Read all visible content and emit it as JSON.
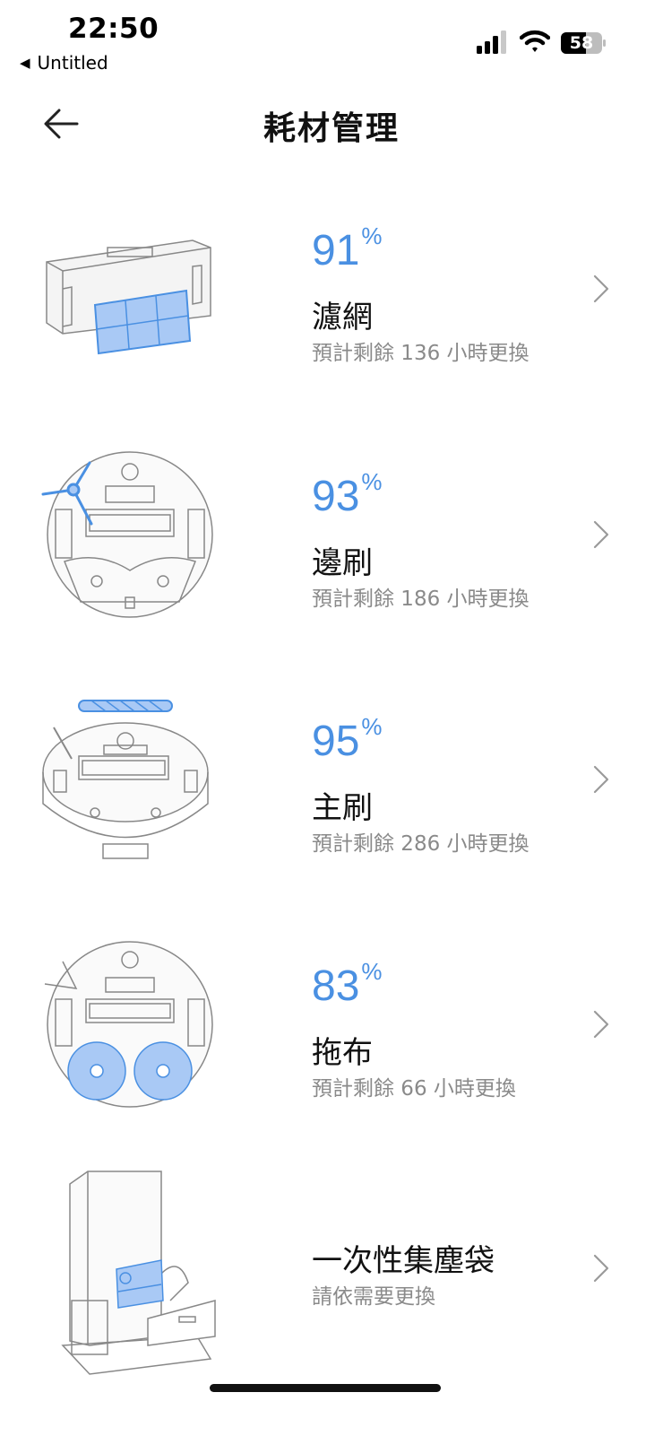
{
  "status": {
    "time": "22:50",
    "back_app": "Untitled",
    "battery": "58"
  },
  "header": {
    "title": "耗材管理"
  },
  "items": [
    {
      "percent": "91",
      "unit": "%",
      "name": "濾網",
      "detail": "預計剩餘 136 小時更換"
    },
    {
      "percent": "93",
      "unit": "%",
      "name": "邊刷",
      "detail": "預計剩餘 186 小時更換"
    },
    {
      "percent": "95",
      "unit": "%",
      "name": "主刷",
      "detail": "預計剩餘 286 小時更換"
    },
    {
      "percent": "83",
      "unit": "%",
      "name": "拖布",
      "detail": "預計剩餘 66 小時更換"
    },
    {
      "name": "一次性集塵袋",
      "detail": "請依需要更換"
    }
  ],
  "colors": {
    "accent": "#4a90e2",
    "accent_light": "#a9c9f5",
    "line": "#888888"
  }
}
